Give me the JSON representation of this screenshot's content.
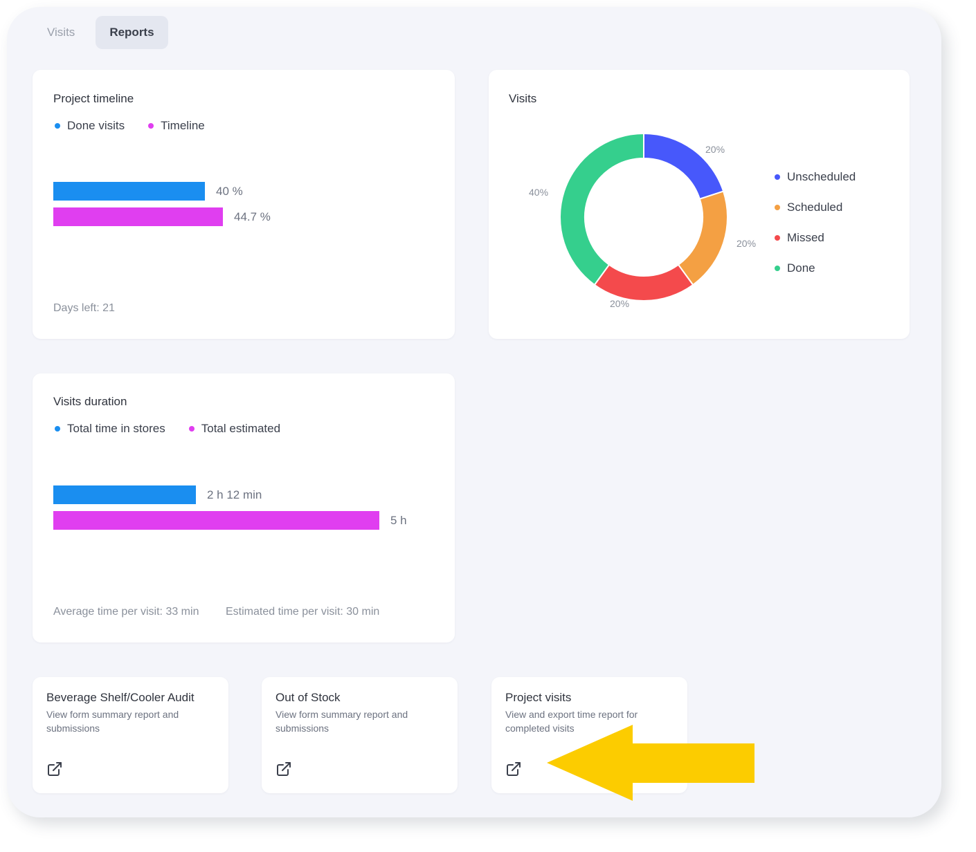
{
  "tabs": [
    {
      "label": "Visits",
      "active": false
    },
    {
      "label": "Reports",
      "active": true
    }
  ],
  "project_timeline": {
    "title": "Project timeline",
    "legend": [
      {
        "label": "Done visits",
        "color": "#1a8ef0"
      },
      {
        "label": "Timeline",
        "color": "#e03ef0"
      }
    ],
    "bars": [
      {
        "label": "40 %",
        "value": 40,
        "color": "#1a8ef0"
      },
      {
        "label": "44.7 %",
        "value": 44.7,
        "color": "#e03ef0"
      }
    ],
    "footer": "Days left: 21"
  },
  "visits_chart": {
    "title": "Visits",
    "chart_data": {
      "type": "pie",
      "title": "Visits",
      "categories": [
        "Unscheduled",
        "Scheduled",
        "Missed",
        "Done"
      ],
      "values": [
        20,
        20,
        20,
        40
      ],
      "labels": [
        "20%",
        "20%",
        "20%",
        "40%"
      ],
      "colors": [
        "#4758fb",
        "#f4a043",
        "#f44a4c",
        "#35cf8d"
      ],
      "legend_position": "right"
    }
  },
  "visits_duration": {
    "title": "Visits duration",
    "legend": [
      {
        "label": "Total time in stores",
        "color": "#1a8ef0"
      },
      {
        "label": "Total estimated",
        "color": "#e03ef0"
      }
    ],
    "bars": [
      {
        "label": "2 h 12 min",
        "value_minutes": 132,
        "color": "#1a8ef0"
      },
      {
        "label": "5 h",
        "value_minutes": 300,
        "color": "#e03ef0"
      }
    ],
    "footer_avg": "Average time per visit: 33 min",
    "footer_est": "Estimated time per visit: 30 min"
  },
  "report_cards": [
    {
      "title": "Beverage Shelf/Cooler Audit",
      "description": "View form summary report and submissions",
      "icon": "external-link-icon"
    },
    {
      "title": "Out of Stock",
      "description": "View form summary report and submissions",
      "icon": "external-link-icon"
    },
    {
      "title": "Project visits",
      "description": "View and export time report for completed visits",
      "icon": "external-link-icon"
    }
  ],
  "annotation": {
    "icon": "arrow-left-icon",
    "color": "#fccc00"
  }
}
